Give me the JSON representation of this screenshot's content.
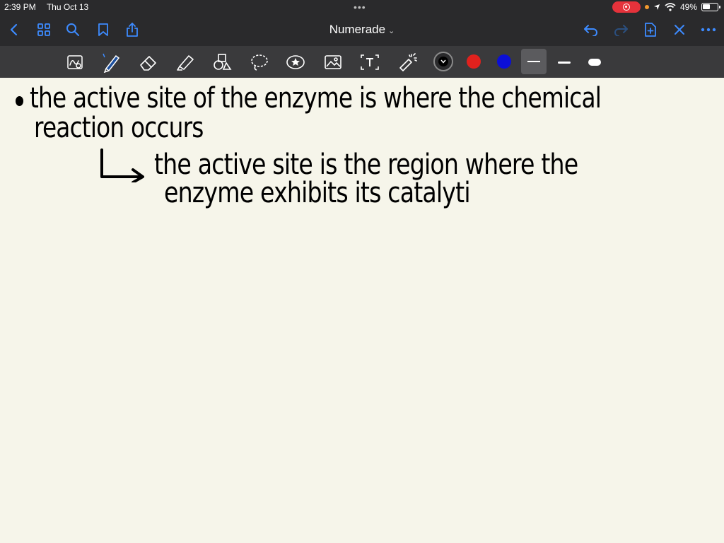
{
  "status_bar": {
    "time": "2:39 PM",
    "date": "Thu Oct 13",
    "battery": "49%",
    "dots": "•••",
    "icons": [
      "record-icon",
      "location-icon",
      "wifi-icon",
      "battery-icon"
    ]
  },
  "nav": {
    "title": "Numerade",
    "icons": [
      "back-chevron-icon",
      "grid-icon",
      "search-icon",
      "bookmark-icon",
      "share-icon",
      "undo-icon",
      "redo-icon",
      "add-page-icon",
      "close-icon",
      "more-icon"
    ]
  },
  "toolbar": {
    "tools": [
      "read-mode-icon",
      "pen-icon",
      "eraser-icon",
      "highlighter-icon",
      "shapes-icon",
      "lasso-icon",
      "sticker-icon",
      "image-icon",
      "text-icon",
      "laser-pointer-icon"
    ],
    "colors": {
      "black": "#000000",
      "red": "#e0211d",
      "blue": "#0b0fd6"
    },
    "stroke_widths": [
      "thin",
      "medium",
      "thick"
    ],
    "selected_width": "thin"
  },
  "notes": {
    "bullet": "•",
    "line1": "the active site of the enzyme is where the chemical",
    "line2": "reaction occurs",
    "arrow": "↳",
    "line3": "the active site is the region where the",
    "line4": "enzyme exhibits its catalyti"
  }
}
